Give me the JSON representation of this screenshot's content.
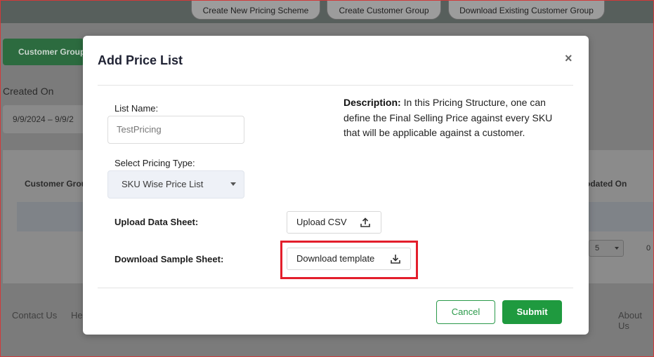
{
  "background": {
    "top_buttons": [
      "Create New Pricing Scheme",
      "Create Customer Group",
      "Download Existing Customer Group"
    ],
    "customer_group_button": "Customer Group",
    "created_on_label": "Created On",
    "date_range": "9/9/2024 – 9/9/2",
    "table_headers": {
      "customer_group": "Customer Grou",
      "updated_on": "odated On"
    },
    "pager": {
      "rows_value": "5",
      "count": "0"
    },
    "footer_links": [
      "Contact Us",
      "Hel",
      "About Us"
    ]
  },
  "modal": {
    "title": "Add Price List",
    "close_label": "×",
    "list_name_label": "List Name:",
    "list_name_value": "TestPricing",
    "pricing_type_label": "Select Pricing Type:",
    "pricing_type_value": "SKU Wise Price List",
    "description_label": "Description:",
    "description_text": " In this Pricing Structure, one can define the Final Selling Price against every SKU that will be applicable against a customer.",
    "upload_label": "Upload Data Sheet:",
    "upload_button": "Upload CSV",
    "download_label": "Download Sample Sheet:",
    "download_button": "Download template",
    "cancel_button": "Cancel",
    "submit_button": "Submit"
  },
  "colors": {
    "accent_green": "#1f9a3f",
    "highlight_red": "#e31e2b"
  },
  "icons": [
    "close-icon",
    "upload-icon",
    "download-icon",
    "caret-down-icon"
  ]
}
